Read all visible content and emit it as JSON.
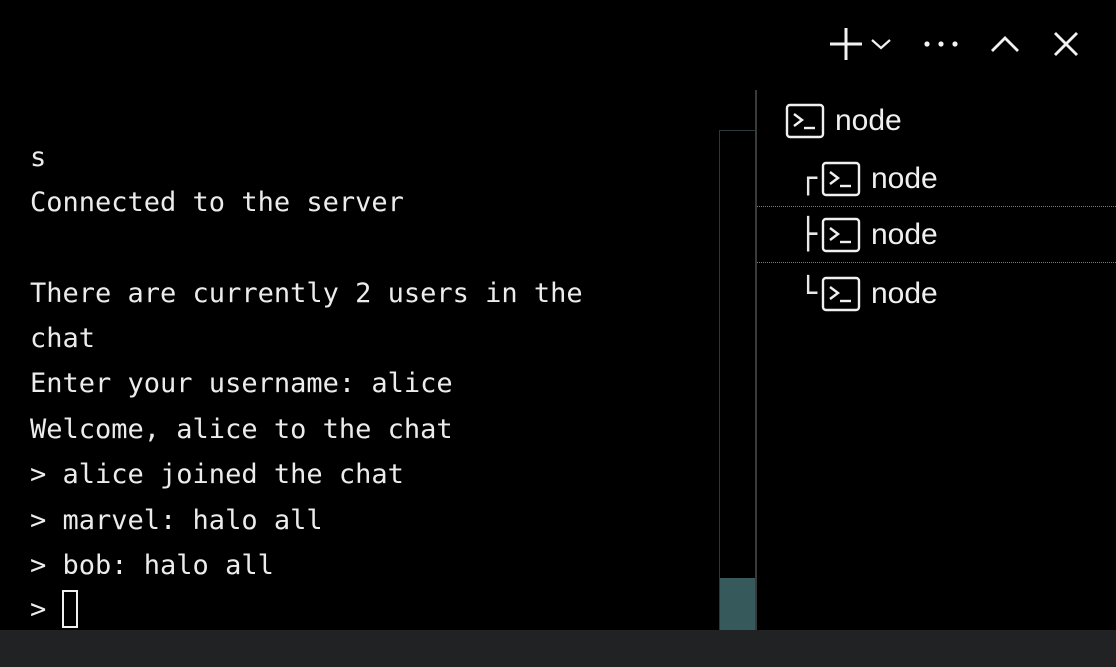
{
  "toolbar": {
    "add_icon": "plus-icon",
    "dropdown_icon": "chevron-down-icon",
    "more_icon": "ellipsis-icon",
    "maximize_icon": "chevron-up-icon",
    "close_icon": "close-icon"
  },
  "terminal": {
    "lines": [
      "s",
      "Connected to the server",
      "",
      "There are currently 2 users in the",
      "chat",
      "Enter your username: alice",
      "Welcome, alice to the chat",
      "> alice joined the chat",
      "> marvel: halo all",
      "> bob: halo all"
    ],
    "prompt": ">"
  },
  "panel": {
    "items": [
      {
        "label": "node",
        "tree": "",
        "icon": "terminal-icon"
      },
      {
        "label": "node",
        "tree": "┌",
        "icon": "terminal-icon"
      },
      {
        "label": "node",
        "tree": "├",
        "icon": "terminal-icon"
      },
      {
        "label": "node",
        "tree": "└",
        "icon": "terminal-icon"
      }
    ]
  },
  "colors": {
    "background": "#000000",
    "text": "#ececec",
    "scroll_thumb": "#365a5c",
    "selection_border": "#b06a3a",
    "status_bar": "#202224"
  }
}
